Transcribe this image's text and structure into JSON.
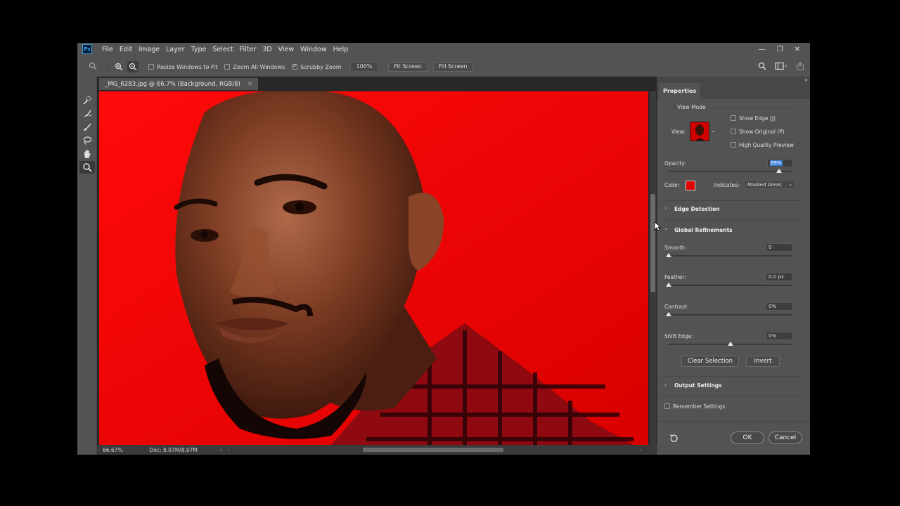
{
  "app": {
    "logo": "Ps",
    "menu": [
      "File",
      "Edit",
      "Image",
      "Layer",
      "Type",
      "Select",
      "Filter",
      "3D",
      "View",
      "Window",
      "Help"
    ]
  },
  "window_controls": {
    "minimize": "—",
    "restore": "❐",
    "close": "✕"
  },
  "options_bar": {
    "resize_windows_label": "Resize Windows to Fit",
    "resize_windows_checked": false,
    "zoom_all_label": "Zoom All Windows",
    "zoom_all_checked": false,
    "scrubby_zoom_label": "Scrubby Zoom",
    "scrubby_zoom_checked": true,
    "zoom_value": "100%",
    "fit_screen": "Fit Screen",
    "fill_screen": "Fill Screen"
  },
  "tools": [
    "quick-selection-icon",
    "refine-edge-brush-icon",
    "brush-icon",
    "lasso-icon",
    "hand-icon",
    "zoom-icon"
  ],
  "document": {
    "tab_title": "_MG_6283.jpg @ 66.7% (Background, RGB/8)",
    "tab_close": "×",
    "zoom_status": "66.67%",
    "doc_status": "Doc: 8.07M/8.07M"
  },
  "properties": {
    "tab": "Properties",
    "view_mode": {
      "section": "View Mode",
      "view_label": "View:",
      "show_edge": "Show Edge (J)",
      "show_original": "Show Original (P)",
      "high_quality": "High Quality Preview"
    },
    "opacity": {
      "label": "Opacity:",
      "value": "89%",
      "level": 0.89
    },
    "color": {
      "label": "Color:",
      "swatch": "#e00000",
      "indicates_label": "Indicates:",
      "indicates_value": "Masked Areas"
    },
    "edge_detection": "Edge Detection",
    "global_refinements": {
      "section": "Global Refinements",
      "smooth": {
        "label": "Smooth:",
        "value": "0",
        "level": 0
      },
      "feather": {
        "label": "Feather:",
        "value": "0.0 px",
        "level": 0
      },
      "contrast": {
        "label": "Contrast:",
        "value": "0%",
        "level": 0
      },
      "shift_edge": {
        "label": "Shift Edge:",
        "value": "0%",
        "level": 0.5
      }
    },
    "clear_selection": "Clear Selection",
    "invert": "Invert",
    "output_settings": "Output Settings",
    "remember_settings": "Remember Settings",
    "ok": "OK",
    "cancel": "Cancel"
  }
}
